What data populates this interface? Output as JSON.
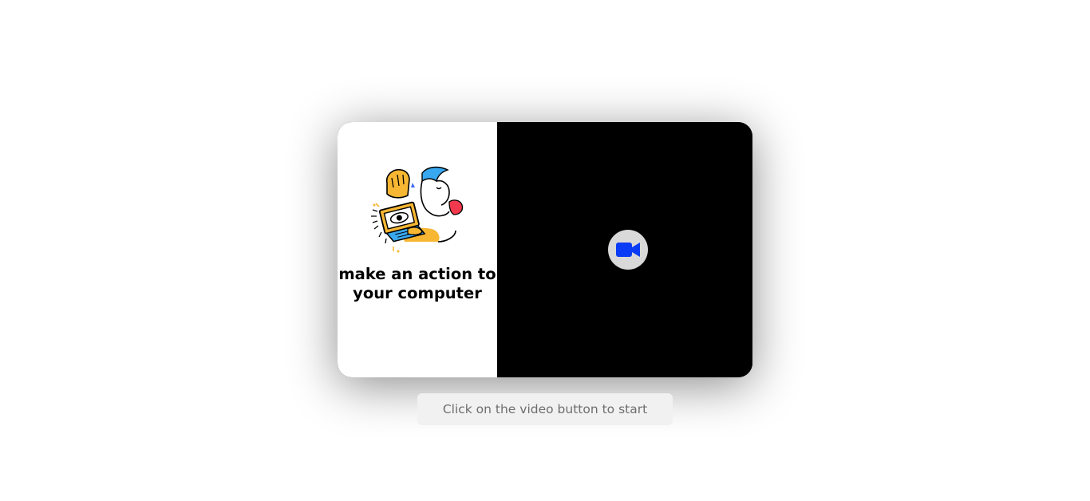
{
  "card": {
    "headline": "make an action to your computer",
    "illustration_icon": "person-with-laptop-eye-illustration",
    "video_button_icon": "video-camera-icon",
    "video_icon_color": "#0a3cf5"
  },
  "hint": {
    "text": "Click on the video button to start"
  }
}
